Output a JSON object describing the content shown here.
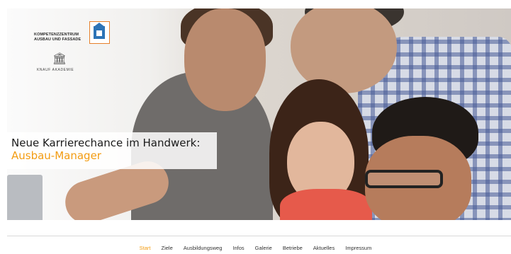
{
  "brand": {
    "logo_line1": "KOMPETENZZENTRUM",
    "logo_line2": "AUSBAU UND FASSADE",
    "knauf_text": "KNAUF AKADEMIE",
    "accent_color": "#f39c12",
    "logo_border_color": "#e6802b",
    "logo_icon_color": "#2d74b6"
  },
  "hero": {
    "headline_line1": "Neue Karrierechance im Handwerk:",
    "headline_line2": "Ausbau-Manager"
  },
  "nav": {
    "items": [
      {
        "label": "Start",
        "active": true
      },
      {
        "label": "Ziele",
        "active": false
      },
      {
        "label": "Ausbildungsweg",
        "active": false
      },
      {
        "label": "Infos",
        "active": false
      },
      {
        "label": "Galerie",
        "active": false
      },
      {
        "label": "Betriebe",
        "active": false
      },
      {
        "label": "Aktuelles",
        "active": false
      },
      {
        "label": "Impressum",
        "active": false
      }
    ]
  }
}
